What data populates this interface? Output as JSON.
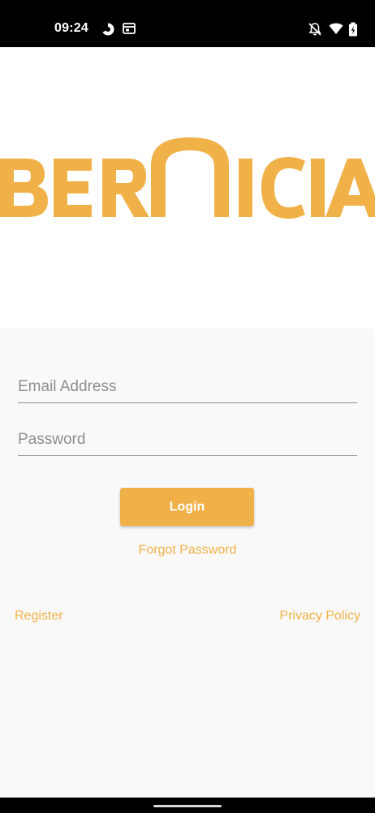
{
  "status_bar": {
    "time": "09:24",
    "left_icons": [
      "data-saver-icon",
      "notification-card-icon"
    ],
    "right_icons": [
      "notifications-off-icon",
      "wifi-icon",
      "battery-icon"
    ]
  },
  "header": {
    "logo_text": "BERNICIA",
    "logo_color": "#f0b248"
  },
  "form": {
    "email_placeholder": "Email Address",
    "email_value": "",
    "password_placeholder": "Password",
    "password_value": "",
    "login_label": "Login",
    "forgot_label": "Forgot Password"
  },
  "footer": {
    "register_label": "Register",
    "privacy_label": "Privacy Policy"
  },
  "colors": {
    "accent": "#f0b248",
    "background": "#faf9fa",
    "header_background": "#ffffff"
  }
}
